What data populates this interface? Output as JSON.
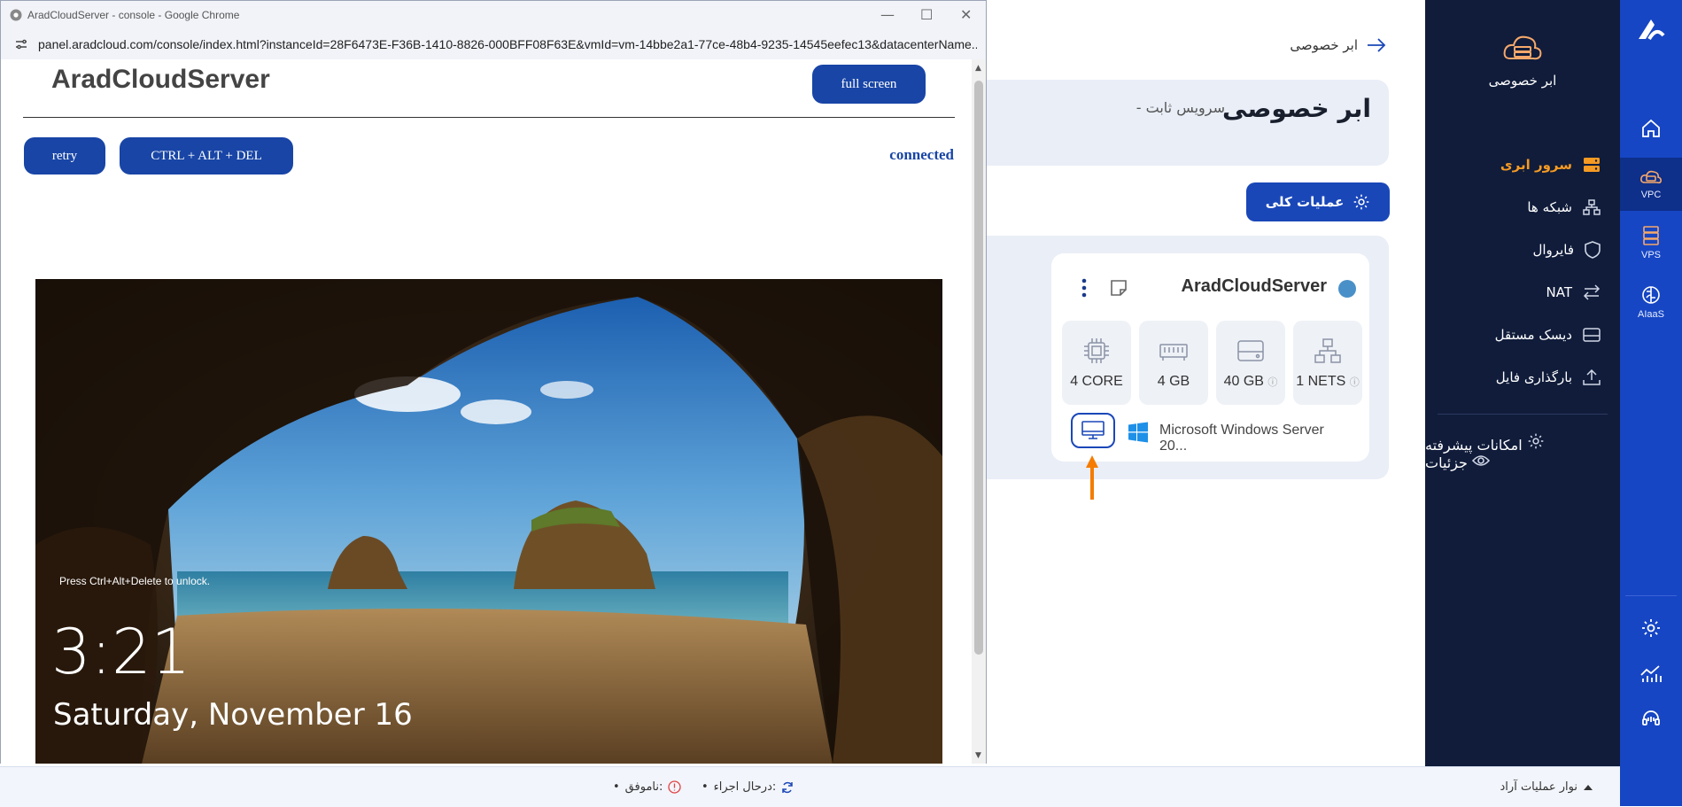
{
  "sidebar": {
    "brand_label": "ابر خصوصی",
    "items": [
      {
        "label": "سرور ابری",
        "icon": "server-icon",
        "active": true
      },
      {
        "label": "شبکه ها",
        "icon": "network-icon"
      },
      {
        "label": "فایروال",
        "icon": "shield-icon"
      },
      {
        "label": "NAT",
        "icon": "nat-arrows-icon"
      },
      {
        "label": "دیسک مستقل",
        "icon": "disk-icon"
      },
      {
        "label": "بارگذاری فایل",
        "icon": "upload-icon"
      }
    ],
    "secondary_items": [
      {
        "label": "امکانات پیشرفته",
        "icon": "gear-icon"
      },
      {
        "label": "جزئیات",
        "icon": "eye-icon"
      }
    ]
  },
  "rail": {
    "items": [
      {
        "label": "",
        "icon": "home-icon"
      },
      {
        "label": "VPC",
        "icon": "cloud-server-icon",
        "active": true
      },
      {
        "label": "VPS",
        "icon": "vps-server-icon"
      },
      {
        "label": "AIaaS",
        "icon": "ai-brain-icon"
      },
      {
        "label": "",
        "icon": "gear-icon"
      },
      {
        "label": "",
        "icon": "analytics-chart-icon"
      },
      {
        "label": "",
        "icon": "headset-icon"
      }
    ]
  },
  "main": {
    "breadcrumb": "ابر خصوصی",
    "title": "ابر خصوصی",
    "subtitle": "- سرویس ثابت",
    "ops_button": "عملیات کلی",
    "server": {
      "name": "AradCloudServer",
      "status_color": "#4a90c8",
      "specs": [
        "4 CORE",
        "4 GB",
        "40 GB",
        "1 NETS"
      ],
      "os": "Microsoft Windows Server 20..."
    }
  },
  "opsbar": {
    "toggle_label": "نوار عملیات آراد",
    "running_label": "درحال اجراء:",
    "running_count": "•",
    "failed_label": "ناموفق:",
    "failed_count": "•"
  },
  "popup": {
    "window_title": "AradCloudServer - console - Google Chrome",
    "url": "panel.aradcloud.com/console/index.html?instanceId=28F6473E-F36B-1410-8826-000BFF08F63E&vmId=vm-14bbe2a1-77ce-48b4-9235-14545eefec13&datacenterName...",
    "heading": "AradCloudServer",
    "fullscreen_label": "full screen",
    "retry_label": "retry",
    "cad_label": "CTRL + ALT + DEL",
    "status": "connected",
    "lock": {
      "message": "Press Ctrl+Alt+Delete to unlock.",
      "time": "3:21",
      "date": "Saturday, November 16"
    }
  },
  "colors": {
    "accent": "#1a47b8",
    "active_menu": "#f59a23",
    "sidebar_bg": "#101c3a",
    "rail_bg": "#1646c4",
    "annotation_arrow": "#f57c00"
  }
}
